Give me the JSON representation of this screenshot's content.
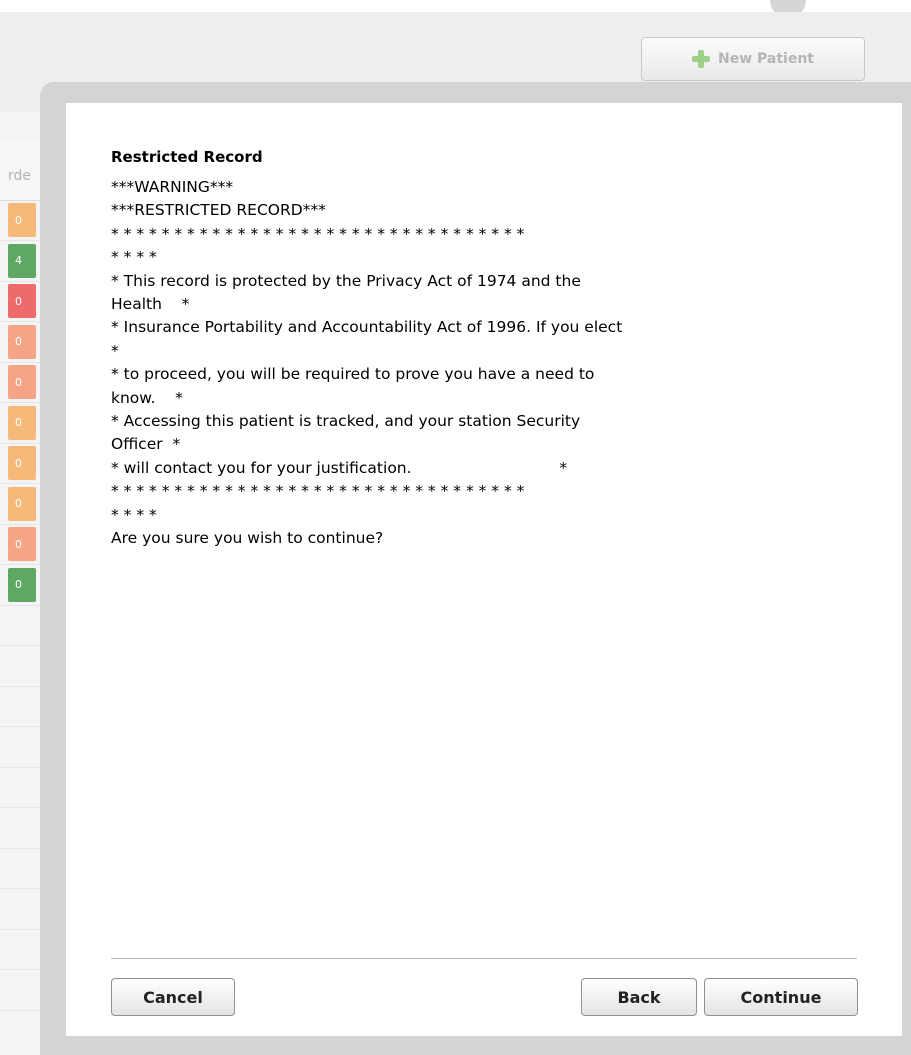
{
  "toolbar": {
    "new_patient_label": "New Patient"
  },
  "table": {
    "column_header_fragment": "rde",
    "cells": [
      {
        "value": "0",
        "color": "#f5b97a"
      },
      {
        "value": "4",
        "color": "#5fa864"
      },
      {
        "value": "0",
        "color": "#ef6a6a"
      },
      {
        "value": "0",
        "color": "#f5a486"
      },
      {
        "value": "0",
        "color": "#f5a486"
      },
      {
        "value": "0",
        "color": "#f5b97a"
      },
      {
        "value": "0",
        "color": "#f5b97a"
      },
      {
        "value": "0",
        "color": "#f5b97a"
      },
      {
        "value": "0",
        "color": "#f5a486"
      },
      {
        "value": "0",
        "color": "#5fa864"
      }
    ]
  },
  "modal": {
    "title": "Restricted Record",
    "lines": [
      "***WARNING***",
      "***RESTRICTED RECORD***",
      "* * * * * * * * * * * * * * * * * * * * * * * * * * * * * * * * *",
      "* * * *",
      "* This record is protected by the Privacy Act of 1974 and the",
      "Health    *",
      "* Insurance Portability and Accountability Act of 1996. If you elect",
      "*",
      "* to proceed, you will be required to prove you have a need to",
      "know.    *",
      "* Accessing this patient is tracked, and your station Security",
      "Officer  *",
      "* will contact you for your justification.                              *",
      "* * * * * * * * * * * * * * * * * * * * * * * * * * * * * * * * *",
      "* * * *",
      "Are you sure you wish to continue?"
    ],
    "buttons": {
      "cancel": "Cancel",
      "back": "Back",
      "continue": "Continue"
    }
  }
}
